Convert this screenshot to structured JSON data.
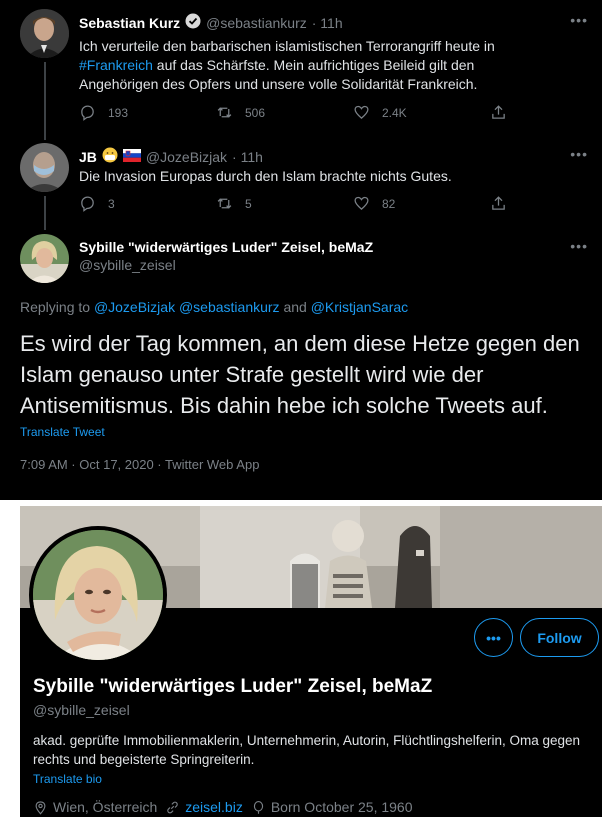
{
  "tweets": [
    {
      "name": "Sebastian Kurz",
      "handle": "@sebastiankurz",
      "time": "· 11h",
      "text_before": "Ich verurteile den barbarischen islamistischen Terrorangriff heute in ",
      "hashtag": "#Frankreich",
      "text_after": " auf das Schärfste. Mein aufrichtiges Beileid gilt den Angehörigen des Opfers und unsere volle Solidarität Frankreich.",
      "replies": "193",
      "retweets": "506",
      "likes": "2.4K"
    },
    {
      "name": "JB",
      "handle": "@JozeBizjak",
      "time": "· 11h",
      "text": "Die Invasion Europas durch den Islam brachte nichts Gutes.",
      "replies": "3",
      "retweets": "5",
      "likes": "82"
    }
  ],
  "main_tweet": {
    "name": "Sybille \"widerwärtiges Luder\" Zeisel, beMaZ",
    "handle": "@sybille_zeisel",
    "replying_prefix": "Replying to",
    "replying_users": "@JozeBizjak @sebastiankurz",
    "replying_and": "and",
    "replying_last": "@KristjanSarac",
    "text": "Es wird der Tag kommen, an dem diese  Hetze gegen den Islam genauso unter Strafe gestellt wird wie der Antisemitismus. Bis dahin hebe ich solche Tweets auf.",
    "translate": "Translate Tweet",
    "meta": "7:09 AM · Oct 17, 2020 · Twitter Web App"
  },
  "profile": {
    "more_label": "•••",
    "follow_label": "Follow",
    "name": "Sybille \"widerwärtiges Luder\" Zeisel, beMaZ",
    "handle": "@sybille_zeisel",
    "bio": "akad. geprüfte Immobilienmaklerin, Unternehmerin, Autorin, Flüchtlingshelferin, Oma gegen rechts und begeisterte Springreiterin.",
    "translate": "Translate bio",
    "location": "Wien, Österreich",
    "website": "zeisel.biz",
    "born": "Born October 25, 1960"
  },
  "icons": {
    "more": "more-dots-icon",
    "reply": "reply-icon",
    "retweet": "retweet-icon",
    "like": "heart-icon",
    "share": "share-icon",
    "verified": "verified-badge-icon",
    "location": "location-pin-icon",
    "link": "link-icon",
    "born": "balloon-icon"
  },
  "colors": {
    "background": "#000000",
    "accent": "#1d9bf0",
    "muted": "#7b8187",
    "text": "#dfe2e5"
  }
}
